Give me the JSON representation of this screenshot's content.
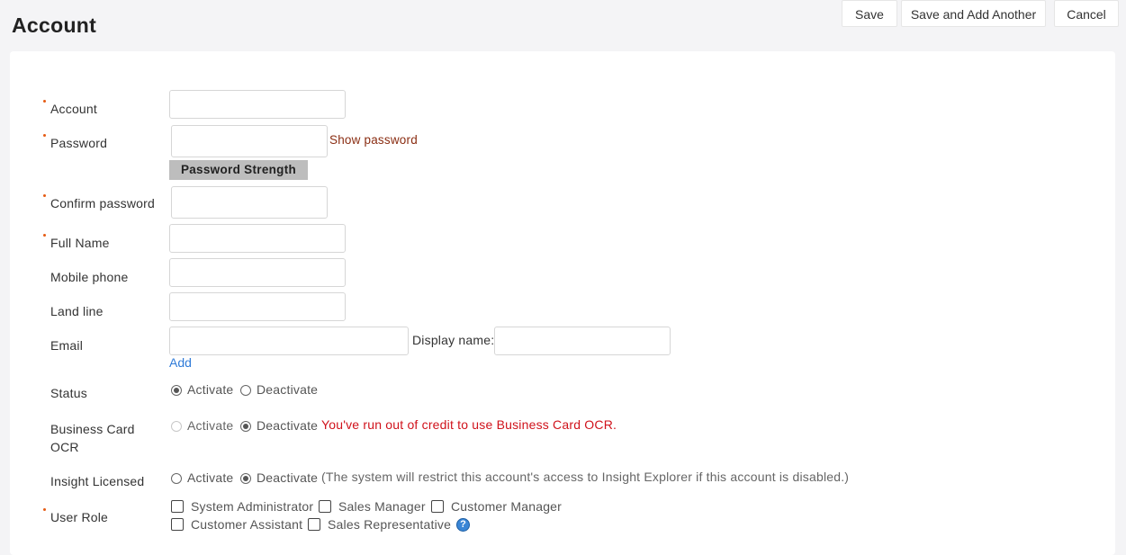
{
  "header": {
    "title": "Account",
    "save_label": "Save",
    "save_add_label": "Save and Add Another",
    "cancel_label": "Cancel"
  },
  "form": {
    "account": {
      "label": "Account",
      "value": ""
    },
    "password": {
      "label": "Password",
      "value": "",
      "show_password_link": "Show password",
      "strength_label": "Password Strength"
    },
    "confirm_password": {
      "label": "Confirm password",
      "value": ""
    },
    "full_name": {
      "label": "Full Name",
      "value": ""
    },
    "mobile_phone": {
      "label": "Mobile phone",
      "value": ""
    },
    "land_line": {
      "label": "Land line",
      "value": ""
    },
    "email": {
      "label": "Email",
      "value": "",
      "display_name_label": "Display name:",
      "display_name_value": "",
      "add_link": "Add"
    },
    "status": {
      "label": "Status",
      "options": [
        "Activate",
        "Deactivate"
      ],
      "selected": "Activate"
    },
    "business_card_ocr": {
      "label_line1": "Business Card",
      "label_line2": "OCR",
      "options": [
        "Activate",
        "Deactivate"
      ],
      "selected": "Deactivate",
      "note": "You've run out of credit to use Business Card OCR."
    },
    "insight_licensed": {
      "label": "Insight Licensed",
      "options": [
        "Activate",
        "Deactivate"
      ],
      "selected": "Deactivate",
      "note": "(The system will restrict this account's access to Insight Explorer if this account is disabled.)"
    },
    "user_role": {
      "label": "User Role",
      "roles": [
        "System Administrator",
        "Sales Manager",
        "Customer Manager",
        "Customer Assistant",
        "Sales Representative"
      ],
      "help_icon": "question-icon"
    }
  },
  "colors": {
    "required_marker": "#e55b13",
    "link_blue": "#2f7bd8",
    "warning_red": "#d0121b",
    "link_brown": "#8a2d12"
  }
}
